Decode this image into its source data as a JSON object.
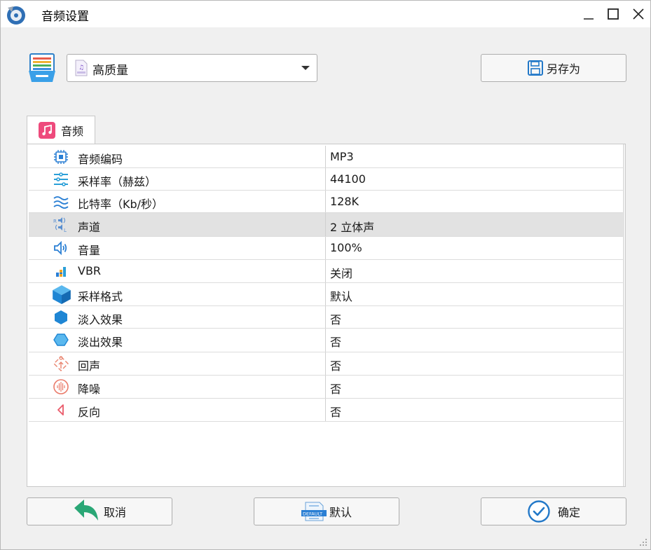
{
  "window": {
    "title": "音频设置"
  },
  "preset": {
    "selected": "高质量",
    "save_as_label": "另存为",
    "file_icon": "audio-file-icon"
  },
  "tabs": [
    {
      "label": "音频",
      "icon": "music-note-icon"
    }
  ],
  "properties": [
    {
      "name": "音频编码",
      "value": "MP3",
      "icon": "chip-icon"
    },
    {
      "name": "采样率（赫兹）",
      "value": "44100",
      "icon": "waveform-nodes-icon"
    },
    {
      "name": "比特率（Kb/秒）",
      "value": "128K",
      "icon": "waves-icon"
    },
    {
      "name": "声道",
      "value": "2 立体声",
      "icon": "stereo-rl-icon",
      "selected": true
    },
    {
      "name": "音量",
      "value": "100%",
      "icon": "speaker-icon"
    },
    {
      "name": "VBR",
      "value": "关闭",
      "icon": "bars-icon"
    },
    {
      "name": "采样格式",
      "value": "默认",
      "icon": "cube-icon"
    },
    {
      "name": "淡入效果",
      "value": "否",
      "icon": "hexagon-filled-icon"
    },
    {
      "name": "淡出效果",
      "value": "否",
      "icon": "hexagon-outline-icon"
    },
    {
      "name": "回声",
      "value": "否",
      "icon": "echo-icon"
    },
    {
      "name": "降噪",
      "value": "否",
      "icon": "noise-reduction-icon"
    },
    {
      "name": "反向",
      "value": "否",
      "icon": "reverse-icon"
    }
  ],
  "footer": {
    "cancel_label": "取消",
    "default_label": "默认",
    "ok_label": "确定",
    "default_badge": "DEFAULT"
  },
  "colors": {
    "accent_blue": "#1f7fd6",
    "green": "#2aa776",
    "pink": "#e84a7a",
    "selected_row": "#e2e2e2"
  }
}
